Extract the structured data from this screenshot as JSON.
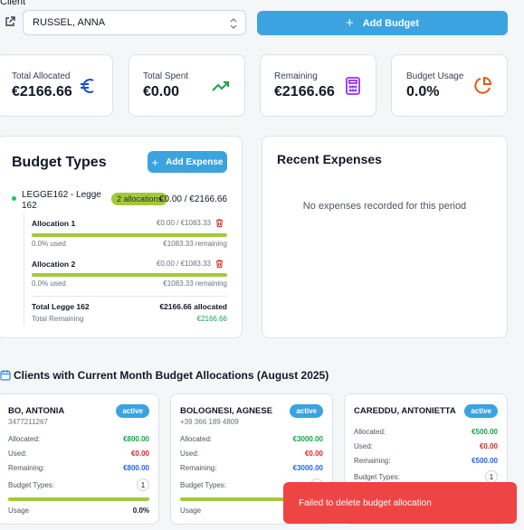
{
  "header": {
    "client_label": "Client",
    "client_selected": "RUSSEL, ANNA",
    "add_budget_label": "Add Budget"
  },
  "stats": [
    {
      "label": "Total Allocated",
      "value": "€2166.66",
      "icon": "euro-icon",
      "color": "#1d4ed8"
    },
    {
      "label": "Total Spent",
      "value": "€0.00",
      "icon": "trending-up-icon",
      "color": "#16a34a"
    },
    {
      "label": "Remaining",
      "value": "€2166.66",
      "icon": "calculator-icon",
      "color": "#9333ea"
    },
    {
      "label": "Budget Usage",
      "value": "0.0%",
      "icon": "pie-chart-icon",
      "color": "#ea580c"
    }
  ],
  "budget_types": {
    "title": "Budget Types",
    "add_expense_label": "Add Expense",
    "type": {
      "name_line1": "LEGGE162 - Legge",
      "name_line2": "162",
      "badge": "2 allocations",
      "amount": "€0.00 / €2166.66"
    },
    "allocations": [
      {
        "label": "Allocation 1",
        "amount": "€0.00 / €1083.33",
        "used": "0.0% used",
        "remaining": "€1083.33 remaining",
        "usage_fraction": 0.0
      },
      {
        "label": "Allocation 2",
        "amount": "€0.00 / €1083.33",
        "used": "0.0% used",
        "remaining": "€1083.33 remaining",
        "usage_fraction": 0.0
      }
    ],
    "total_label": "Total Legge 162",
    "total_value": "€2166.66 allocated",
    "total_remaining_label": "Total Remaining",
    "total_remaining_value": "€2166.66"
  },
  "recent_expenses": {
    "title": "Recent Expenses",
    "empty": "No expenses recorded for this period"
  },
  "clients_section": {
    "title": "Clients with Current Month Budget Allocations (August 2025)",
    "labels": {
      "allocated": "Allocated:",
      "used": "Used:",
      "remaining": "Remaining:",
      "budget_types": "Budget Types:",
      "usage": "Usage"
    },
    "clients": [
      {
        "name": "BO, ANTONIA",
        "phone": "3477211267",
        "status": "active",
        "allocated": "€800.00",
        "used": "€0.00",
        "remaining": "€800.00",
        "budget_types": "1",
        "usage": "0.0%"
      },
      {
        "name": "BOLOGNESI, AGNESE",
        "phone": "+39 366 189 4809",
        "status": "active",
        "allocated": "€3000.00",
        "used": "€0.00",
        "remaining": "€3000.00",
        "budget_types": "1",
        "usage": ""
      },
      {
        "name": "CAREDDU, ANTONIETTA",
        "phone": "",
        "status": "active",
        "allocated": "€500.00",
        "used": "€0.00",
        "remaining": "€500.00",
        "budget_types": "1",
        "usage": ""
      }
    ]
  },
  "toast": {
    "message": "Failed to delete budget allocation",
    "color": "#ef4444"
  },
  "colors": {
    "accent": "#3ba3e0",
    "bar": "#a3c93a"
  }
}
